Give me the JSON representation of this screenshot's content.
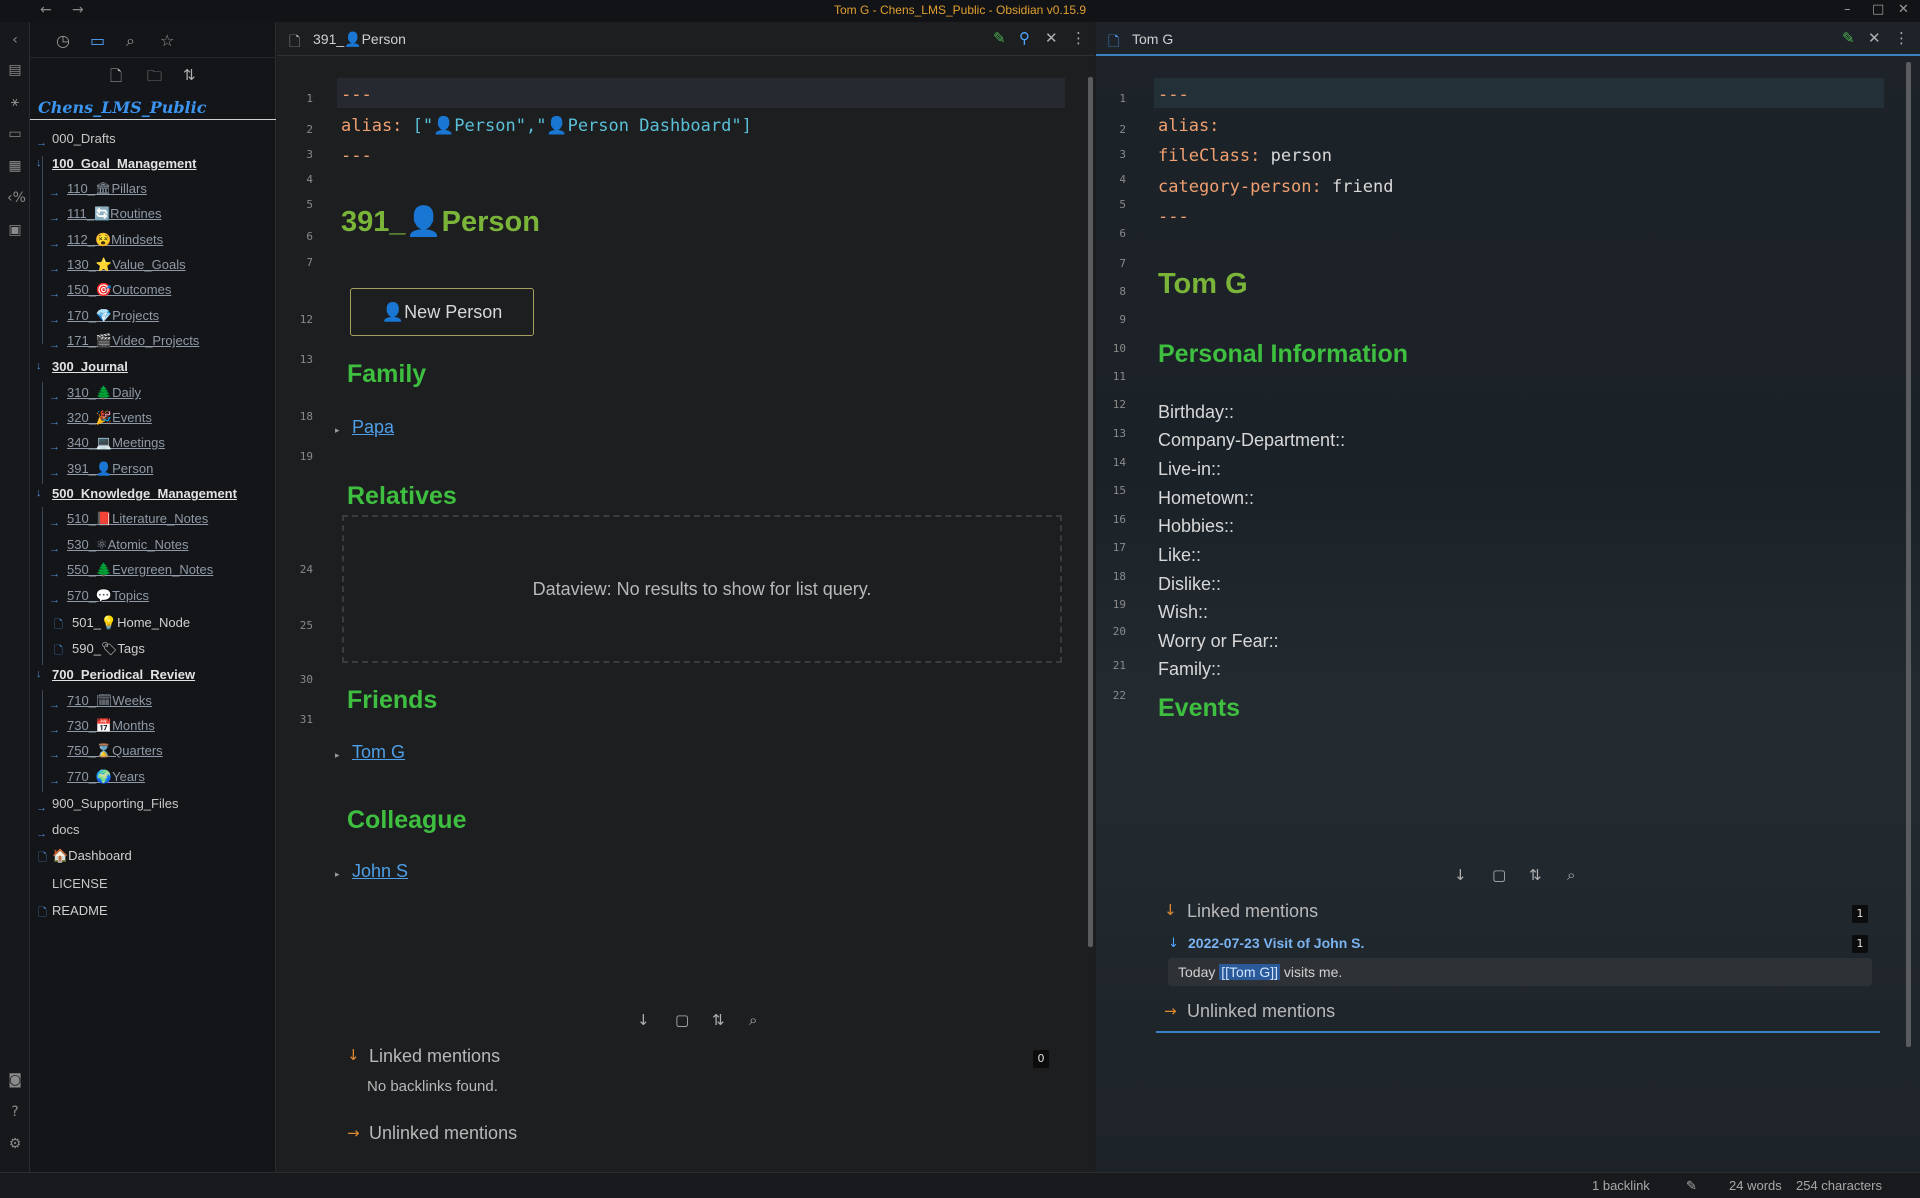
{
  "window": {
    "title": "Tom G - Chens_LMS_Public - Obsidian v0.15.9",
    "back_icon": "←",
    "forward_icon": "→",
    "minimize": "–",
    "maximize": "□",
    "close": "✕"
  },
  "sidebar": {
    "vault_name": "Chens_LMS_Public",
    "tree": [
      {
        "label": "000_Drafts",
        "type": "plain"
      },
      {
        "label": "100_Goal_Management",
        "type": "fold"
      },
      {
        "label": "110_🏛Pillars",
        "type": "sub"
      },
      {
        "label": "111_🔄Routines",
        "type": "sub"
      },
      {
        "label": "112_😵Mindsets",
        "type": "sub"
      },
      {
        "label": "130_⭐Value_Goals",
        "type": "sub"
      },
      {
        "label": "150_🎯Outcomes",
        "type": "sub"
      },
      {
        "label": "170_💎Projects",
        "type": "sub"
      },
      {
        "label": "171_🎬Video_Projects",
        "type": "sub"
      },
      {
        "label": "300_Journal",
        "type": "fold"
      },
      {
        "label": "310_🌲Daily",
        "type": "sub"
      },
      {
        "label": "320_🎉Events",
        "type": "sub"
      },
      {
        "label": "340_💻Meetings",
        "type": "sub"
      },
      {
        "label": "391_👤Person",
        "type": "sub"
      },
      {
        "label": "500_Knowledge_Management",
        "type": "fold"
      },
      {
        "label": "510_📕Literature_Notes",
        "type": "sub"
      },
      {
        "label": "530_⚛Atomic_Notes",
        "type": "sub"
      },
      {
        "label": "550_🌲Evergreen_Notes",
        "type": "sub"
      },
      {
        "label": "570_💬Topics",
        "type": "sub"
      },
      {
        "label": "501_💡Home_Node",
        "type": "file1"
      },
      {
        "label": "590_🏷Tags",
        "type": "file1"
      },
      {
        "label": "700_Periodical_Review",
        "type": "fold"
      },
      {
        "label": "710_🗓Weeks",
        "type": "sub"
      },
      {
        "label": "730_📅Months",
        "type": "sub"
      },
      {
        "label": "750_⌛Quarters",
        "type": "sub"
      },
      {
        "label": "770_🌍Years",
        "type": "sub"
      },
      {
        "label": "900_Supporting_Files",
        "type": "plain"
      },
      {
        "label": "docs",
        "type": "plain"
      },
      {
        "label": "🏠Dashboard",
        "type": "file0"
      },
      {
        "label": "LICENSE",
        "type": "plainfile"
      },
      {
        "label": "README",
        "type": "file0"
      }
    ]
  },
  "left_pane": {
    "tab_title": "391_👤Person",
    "line_numbers": [
      "1",
      "2",
      "3",
      "4",
      "5",
      "6",
      "7",
      "12",
      "13",
      "18",
      "19",
      "24",
      "25",
      "30",
      "31"
    ],
    "fm_dash": "---",
    "alias_key": "alias:",
    "alias_value": "[\"👤Person\",\"👤Person Dashboard\"]",
    "title": "391_👤Person",
    "new_person_button": "👤New Person",
    "family_heading": "Family",
    "family_link": "Papa",
    "relatives_heading": "Relatives",
    "dataview_message": "Dataview: No results to show for list query.",
    "friends_heading": "Friends",
    "friends_link": "Tom G",
    "colleague_heading": "Colleague",
    "colleague_link": "John S",
    "linked_mentions": "Linked mentions",
    "linked_count": "0",
    "no_backlinks": "No backlinks found.",
    "unlinked_mentions": "Unlinked mentions"
  },
  "right_pane": {
    "tab_title": "Tom G",
    "line_numbers": [
      "1",
      "2",
      "3",
      "4",
      "5",
      "6",
      "7",
      "8",
      "9",
      "10",
      "11",
      "12",
      "13",
      "14",
      "15",
      "16",
      "17",
      "18",
      "19",
      "20",
      "21",
      "22"
    ],
    "fm_dash": "---",
    "alias_key": "alias:",
    "fileclass_key": "fileClass:",
    "fileclass_value": "person",
    "category_key": "category-person:",
    "category_value": "friend",
    "title": "Tom G",
    "personal_heading": "Personal Information",
    "fields": [
      "Birthday::",
      "Company-Department::",
      "Live-in::",
      "Hometown::",
      "Hobbies::",
      "Like::",
      "Dislike::",
      "Wish::",
      "Worry or Fear::",
      "Family::"
    ],
    "events_heading": "Events",
    "linked_mentions": "Linked mentions",
    "linked_count": "1",
    "mention_file": "2022-07-23 Visit of John S.",
    "mention_file_count": "1",
    "mention_before": "Today ",
    "mention_link": "[[Tom G]]",
    "mention_after": " visits me.",
    "unlinked_mentions": "Unlinked mentions"
  },
  "status_bar": {
    "backlinks": "1 backlink",
    "words": "24 words",
    "characters": "254 characters"
  }
}
